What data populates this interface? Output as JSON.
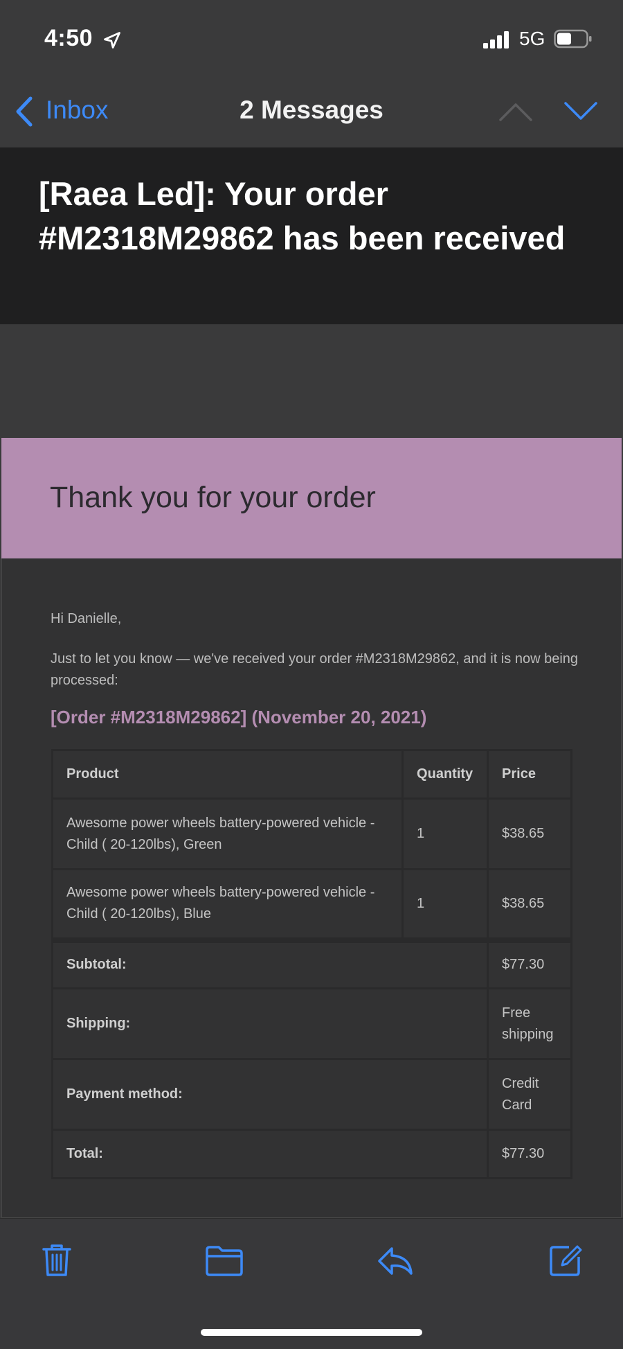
{
  "status_bar": {
    "time": "4:50",
    "network": "5G"
  },
  "nav": {
    "back_label": "Inbox",
    "title": "2 Messages"
  },
  "subject": "[Raea Led]: Your order #M2318M29862 has been received",
  "email": {
    "banner_title": "Thank you for your order",
    "greeting": "Hi Danielle,",
    "intro": "Just to let you know — we've received your order #M2318M29862, and it is now being processed:",
    "order_heading": "[Order #M2318M29862] (November 20, 2021)",
    "table": {
      "headers": {
        "product": "Product",
        "quantity": "Quantity",
        "price": "Price"
      },
      "items": [
        {
          "product": "Awesome power wheels battery-powered vehicle - Child ( 20-120lbs), Green",
          "quantity": "1",
          "price": "$38.65"
        },
        {
          "product": "Awesome power wheels battery-powered vehicle - Child ( 20-120lbs), Blue",
          "quantity": "1",
          "price": "$38.65"
        }
      ],
      "totals": [
        {
          "label": "Subtotal:",
          "value": "$77.30"
        },
        {
          "label": "Shipping:",
          "value": "Free shipping"
        },
        {
          "label": "Payment method:",
          "value": "Credit Card"
        },
        {
          "label": "Total:",
          "value": "$77.30"
        }
      ]
    }
  },
  "colors": {
    "accent": "#3d8af7",
    "banner": "#b48db1",
    "background": "#3a3a3b"
  },
  "toolbar": {
    "icons": [
      "trash-icon",
      "folder-icon",
      "reply-icon",
      "compose-icon"
    ]
  }
}
